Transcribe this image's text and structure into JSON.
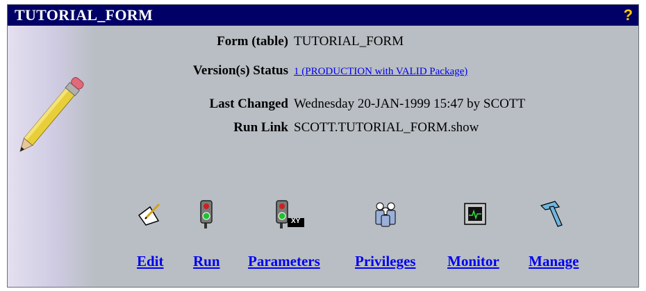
{
  "window": {
    "title": "TUTORIAL_FORM",
    "help_icon": "?"
  },
  "details": {
    "form_label": "Form (table)",
    "form_value": "TUTORIAL_FORM",
    "version_label": "Version(s) Status",
    "version_value": "1 (PRODUCTION with VALID Package)",
    "changed_label": "Last Changed",
    "changed_value": "Wednesday 20-JAN-1999 15:47 by SCOTT",
    "runlink_label": "Run Link",
    "runlink_value": "SCOTT.TUTORIAL_FORM.show"
  },
  "actions": [
    {
      "label": "Edit",
      "icon": "edit-icon"
    },
    {
      "label": "Run",
      "icon": "traffic-light-icon"
    },
    {
      "label": "Parameters",
      "icon": "traffic-light-xy-icon",
      "icon_text": "XY"
    },
    {
      "label": "Privileges",
      "icon": "people-icon"
    },
    {
      "label": "Monitor",
      "icon": "monitor-icon"
    },
    {
      "label": "Manage",
      "icon": "hammer-icon"
    }
  ],
  "colors": {
    "titlebar": "#000066",
    "link": "#0000ee",
    "background": "#b9bec4"
  }
}
